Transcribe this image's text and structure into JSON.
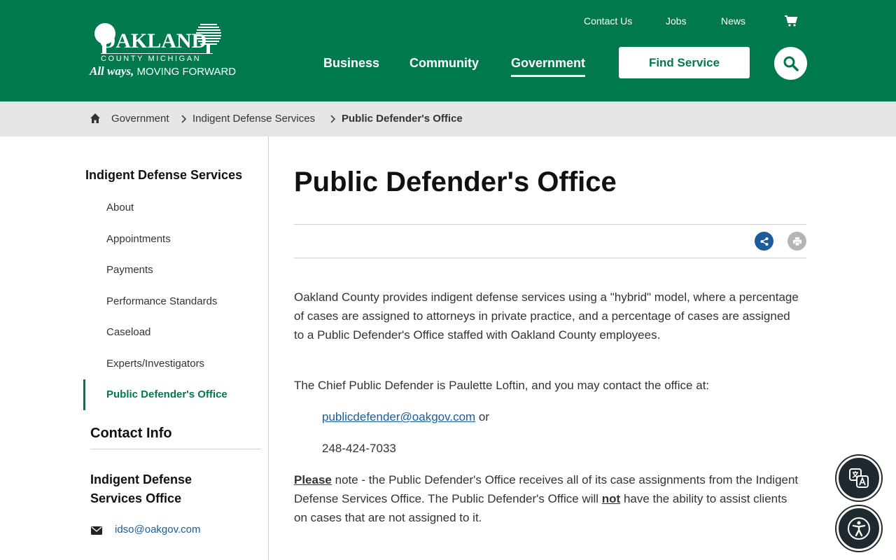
{
  "header": {
    "logo": {
      "wordmark": "OAKLAND",
      "subtitle": "COUNTY MICHIGAN",
      "tagline_script": "All ways,",
      "tagline": "MOVING FORWARD"
    },
    "utility": [
      "Contact Us",
      "Jobs",
      "News"
    ],
    "nav": [
      "Business",
      "Community",
      "Government"
    ],
    "active_nav": "Government",
    "find_service": "Find Service",
    "brand_color": "#007a4d"
  },
  "breadcrumb": [
    "Government",
    "Indigent Defense Services",
    "Public Defender's Office"
  ],
  "sidebar": {
    "title": "Indigent Defense Services",
    "items": [
      "About",
      "Appointments",
      "Payments",
      "Performance Standards",
      "Caseload",
      "Experts/Investigators",
      "Public Defender's Office"
    ],
    "active": "Public Defender's Office",
    "contact_title": "Contact Info",
    "office_name": "Indigent Defense Services Office",
    "email": "idso@oakgov.com"
  },
  "main": {
    "title": "Public Defender's Office",
    "p1": "Oakland County provides indigent defense services using a \"hybrid\" model, where a percentage of cases are assigned to attorneys in private practice, and a percentage of cases are assigned to a Public Defender's Office staffed with Oakland County employees.",
    "p2": "The Chief Public Defender is Paulette Loftin, and you may contact the office at:",
    "email": "publicdefender@oakgov.com",
    "email_suffix": " or",
    "phone": "248-424-7033",
    "note": {
      "please": "Please",
      "part1": " note - the Public Defender's Office receives all of its case assignments from the Indigent Defense Services Office. The Public Defender's Office will ",
      "not": "not",
      "part2": " have the ability to assist clients on cases that are not assigned to it."
    }
  }
}
